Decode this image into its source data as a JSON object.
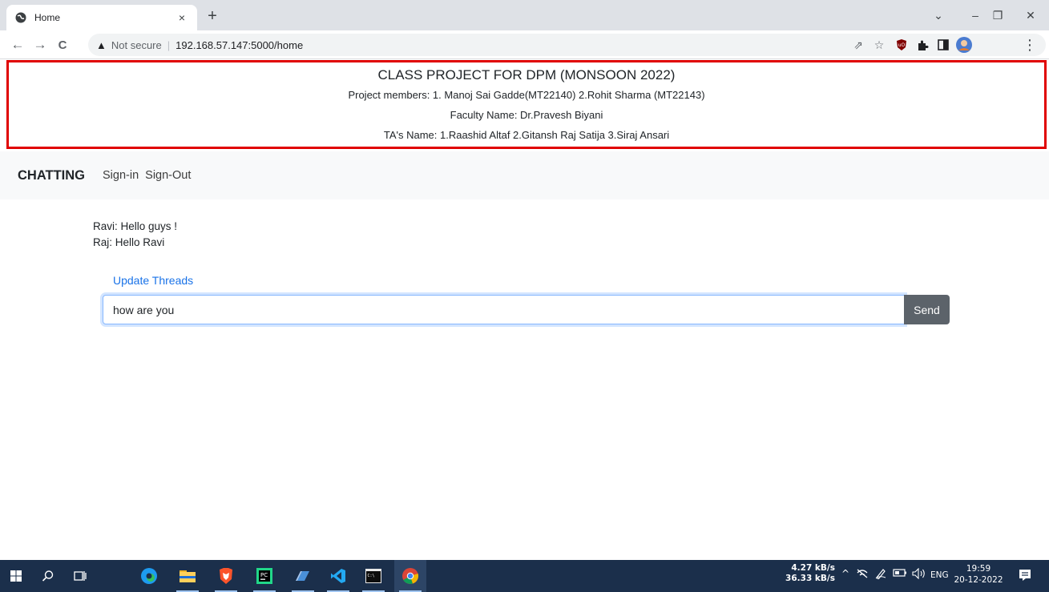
{
  "browser": {
    "tab_title": "Home",
    "tab_close": "×",
    "new_tab": "+",
    "window_controls": {
      "dropdown": "⌄",
      "minimize": "–",
      "restore": "❐",
      "close": "✕"
    },
    "nav": {
      "back": "←",
      "forward": "→",
      "reload": "C"
    },
    "security_icon": "▲",
    "security_label": "Not secure",
    "separator": "|",
    "url": "192.168.57.147:5000/home",
    "toolbar_icons": {
      "share": "⇗",
      "bookmark": "☆",
      "menu": "⋮"
    }
  },
  "banner": {
    "title": "CLASS PROJECT FOR DPM (MONSOON 2022)",
    "members": "Project members: 1. Manoj Sai Gadde(MT22140) 2.Rohit Sharma (MT22143)",
    "faculty": "Faculty Name: Dr.Pravesh Biyani",
    "tas": "TA's Name: 1.Raashid Altaf 2.Gitansh Raj Satija 3.Siraj Ansari",
    "border_color": "#e00000"
  },
  "navbar": {
    "brand": "CHATTING",
    "links": [
      "Sign-in",
      "Sign-Out"
    ]
  },
  "chat": {
    "messages": [
      "Ravi: Hello guys !",
      "Raj: Hello Ravi"
    ],
    "update_link": "Update Threads",
    "input_value": "how are you",
    "send_label": "Send"
  },
  "taskbar": {
    "net_up": "4.27 kB/s",
    "net_down": "36.33 kB/s",
    "tray_chevron": "^",
    "lang": "ENG",
    "time": "19:59",
    "date": "20-12-2022"
  }
}
